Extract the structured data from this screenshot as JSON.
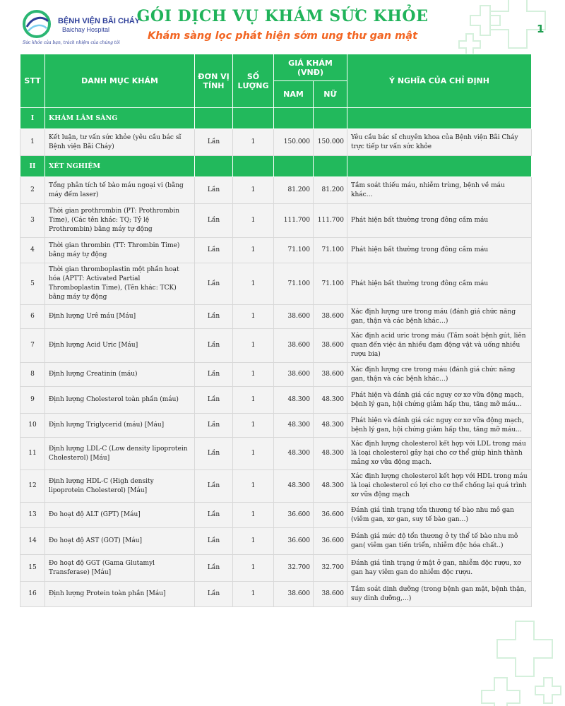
{
  "header": {
    "hospital_name": "BỆNH VIỆN BÃI CHÁY",
    "hospital_name_en": "Baichay Hospital",
    "slogan": "Sức khỏe của bạn, trách nhiệm của chúng tôi",
    "title": "GÓI DỊCH VỤ KHÁM SỨC KHỎE",
    "subtitle": "Khám sàng lọc phát hiện sớm ung thư gan mật",
    "page_number": "1"
  },
  "colors": {
    "brand_green": "#22b95c",
    "title_green": "#20b35a",
    "subtitle_orange": "#f26522",
    "logo_blue": "#2e3f99"
  },
  "table": {
    "headers": {
      "stt": "STT",
      "item": "DANH MỤC KHÁM",
      "unit": "ĐƠN VỊ TÍNH",
      "qty": "SỐ LƯỢNG",
      "price": "GIÁ KHÁM (VNĐ)",
      "male": "NAM",
      "female": "NỮ",
      "meaning": "Ý NGHĨA CỦA CHỈ ĐỊNH"
    },
    "sections": [
      {
        "roman": "I",
        "title": "KHÁM LÂM SÀNG"
      },
      {
        "roman": "II",
        "title": "XÉT NGHIỆM"
      }
    ],
    "rows": [
      {
        "stt": "1",
        "item": "Kết luận, tư vấn sức khỏe (yêu cầu bác sĩ Bệnh viện Bãi Cháy)",
        "unit": "Lần",
        "qty": "1",
        "male": "150.000",
        "female": "150.000",
        "meaning": "Yêu cầu bác sĩ chuyên khoa của Bệnh viện Bãi Cháy trực tiếp tư vấn sức khỏe"
      },
      {
        "stt": "2",
        "item": "Tổng phân tích tế bào máu ngoại vi (bằng máy đếm laser)",
        "unit": "Lần",
        "qty": "1",
        "male": "81.200",
        "female": "81.200",
        "meaning": "Tầm soát thiếu máu, nhiễm trùng, bệnh về máu khác…"
      },
      {
        "stt": "3",
        "item": "Thời gian prothrombin (PT: Prothrombin Time), (Các tên khác: TQ; Tỷ lệ Prothrombin) bằng máy tự động",
        "unit": "Lần",
        "qty": "1",
        "male": "111.700",
        "female": "111.700",
        "meaning": "Phát hiện bất thường trong đông cầm máu"
      },
      {
        "stt": "4",
        "item": "Thời gian thrombin (TT: Thrombin Time) bằng máy tự động",
        "unit": "Lần",
        "qty": "1",
        "male": "71.100",
        "female": "71.100",
        "meaning": "Phát hiện bất thường trong đông cầm máu"
      },
      {
        "stt": "5",
        "item": "Thời gian thromboplastin một phần hoạt hóa (APTT: Activated Partial Thromboplastin Time), (Tên khác: TCK) bằng máy tự động",
        "unit": "Lần",
        "qty": "1",
        "male": "71.100",
        "female": "71.100",
        "meaning": "Phát hiện bất thường trong đông cầm máu"
      },
      {
        "stt": "6",
        "item": "Định lượng Urê máu [Máu]",
        "unit": "Lần",
        "qty": "1",
        "male": "38.600",
        "female": "38.600",
        "meaning": "Xác định lượng ure trong máu (đánh giá chức năng gan, thận và các bệnh khác…)"
      },
      {
        "stt": "7",
        "item": "Định lượng Acid Uric [Máu]",
        "unit": "Lần",
        "qty": "1",
        "male": "38.600",
        "female": "38.600",
        "meaning": "Xác định acid uric trong máu (Tầm soát bệnh gút, liên quan đến việc ăn nhiều đạm động vật và uống nhiều rượu bia)"
      },
      {
        "stt": "8",
        "item": "Định lượng Creatinin (máu)",
        "unit": "Lần",
        "qty": "1",
        "male": "38.600",
        "female": "38.600",
        "meaning": "Xác định lượng cre trong máu (đánh giá chức năng gan, thận và các bệnh khác…)"
      },
      {
        "stt": "9",
        "item": "Định lượng Cholesterol toàn phần (máu)",
        "unit": "Lần",
        "qty": "1",
        "male": "48.300",
        "female": "48.300",
        "meaning": "Phát hiện và đánh giá các nguy cơ xơ vữa động mạch, bệnh lý gan, hội chứng giảm hấp thu, tăng mỡ máu..."
      },
      {
        "stt": "10",
        "item": "Định lượng Triglycerid (máu) [Máu]",
        "unit": "Lần",
        "qty": "1",
        "male": "48.300",
        "female": "48.300",
        "meaning": "Phát hiện và đánh giá các nguy cơ xơ vữa động mạch, bệnh lý gan, hội chứng giảm hấp thu, tăng mỡ máu..."
      },
      {
        "stt": "11",
        "item": "Định lượng LDL-C (Low density lipoprotein Cholesterol) [Máu]",
        "unit": "Lần",
        "qty": "1",
        "male": "48.300",
        "female": "48.300",
        "meaning": "Xác định lượng cholesterol kết hợp với LDL trong máu là loại cholesterol gây hại cho cơ thể giúp hình thành mảng xơ vữa động mạch."
      },
      {
        "stt": "12",
        "item": "Định lượng HDL-C (High density lipoprotein Cholesterol) [Máu]",
        "unit": "Lần",
        "qty": "1",
        "male": "48.300",
        "female": "48.300",
        "meaning": "Xác định lượng cholesterol kết hợp với HDL trong máu là loại cholesterol có lợi cho cơ thể chống lại quá trình xơ vữa động mạch"
      },
      {
        "stt": "13",
        "item": "Đo hoạt độ ALT (GPT) [Máu]",
        "unit": "Lần",
        "qty": "1",
        "male": "36.600",
        "female": "36.600",
        "meaning": "Đánh giá tình trạng tổn thương tế bào nhu mô gan (viêm gan, xơ gan, suy tế bào gan…)"
      },
      {
        "stt": "14",
        "item": "Đo hoạt độ AST (GOT) [Máu]",
        "unit": "Lần",
        "qty": "1",
        "male": "36.600",
        "female": "36.600",
        "meaning": "Đánh giá mức độ tổn thương ở ty thể tế bào nhu mô gan( viêm gan tiến triển, nhiễm độc hóa chất..)"
      },
      {
        "stt": "15",
        "item": "Đo hoạt độ GGT (Gama Glutamyl Transferase) [Máu]",
        "unit": "Lần",
        "qty": "1",
        "male": "32.700",
        "female": "32.700",
        "meaning": "Đánh giá tình trạng ứ mật ở gan, nhiễm độc rượu, xơ gan hay viêm gan do nhiễm độc rượu."
      },
      {
        "stt": "16",
        "item": "Định lượng Protein toàn phần [Máu]",
        "unit": "Lần",
        "qty": "1",
        "male": "38.600",
        "female": "38.600",
        "meaning": "Tầm soát dinh dưỡng (trong bệnh gan mật, bệnh thận, suy dinh dưỡng,…)"
      }
    ]
  }
}
